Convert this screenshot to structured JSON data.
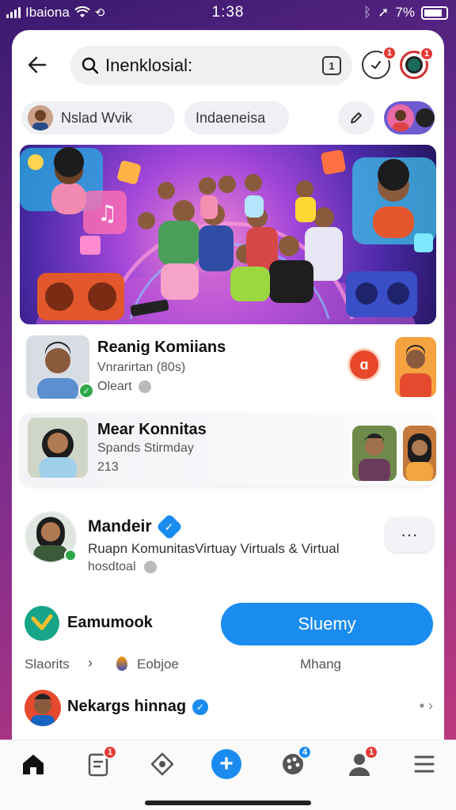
{
  "status_bar": {
    "carrier": "Ibaiona",
    "time": "1:38",
    "battery": "7%"
  },
  "search": {
    "query": "Inenklosial:"
  },
  "header": {
    "notif_count_a": "1",
    "notif_count_b": "1"
  },
  "chips": [
    {
      "label": "Nslad Wvik"
    },
    {
      "label": "Indaeneisa"
    }
  ],
  "communities": [
    {
      "title": "Reanig Komiians",
      "subtitle": "Vnrarirtan (80s)",
      "meta": "Oleart",
      "badge": "ɑ"
    },
    {
      "title": "Mear Konnitas",
      "subtitle": "Spands Stirmday",
      "meta": "213"
    }
  ],
  "profile": {
    "name": "Mandeir",
    "description": "Ruapn KomunitasVirtuay Virtuals & Virtual",
    "meta": "hosdtoal",
    "more_label": "···"
  },
  "action": {
    "brand_label": "Eamumook",
    "follow_label": "Sluemy"
  },
  "meta_row": {
    "left": "Slaorits",
    "middle": "Eobjoe",
    "right": "Mhang"
  },
  "list_item": {
    "name": "Nekargs hinnag"
  },
  "bottom_nav": [
    {
      "icon": "home-icon",
      "badge": ""
    },
    {
      "icon": "clipboard-icon",
      "badge": "1"
    },
    {
      "icon": "compass-icon",
      "badge": ""
    },
    {
      "icon": "add-icon",
      "badge": ""
    },
    {
      "icon": "palette-icon",
      "badge": "4"
    },
    {
      "icon": "person-icon",
      "badge": "1"
    },
    {
      "icon": "menu-icon",
      "badge": ""
    }
  ],
  "colors": {
    "accent": "#1a8cf0",
    "badge": "#e53935",
    "verified": "#1a8cf0"
  }
}
